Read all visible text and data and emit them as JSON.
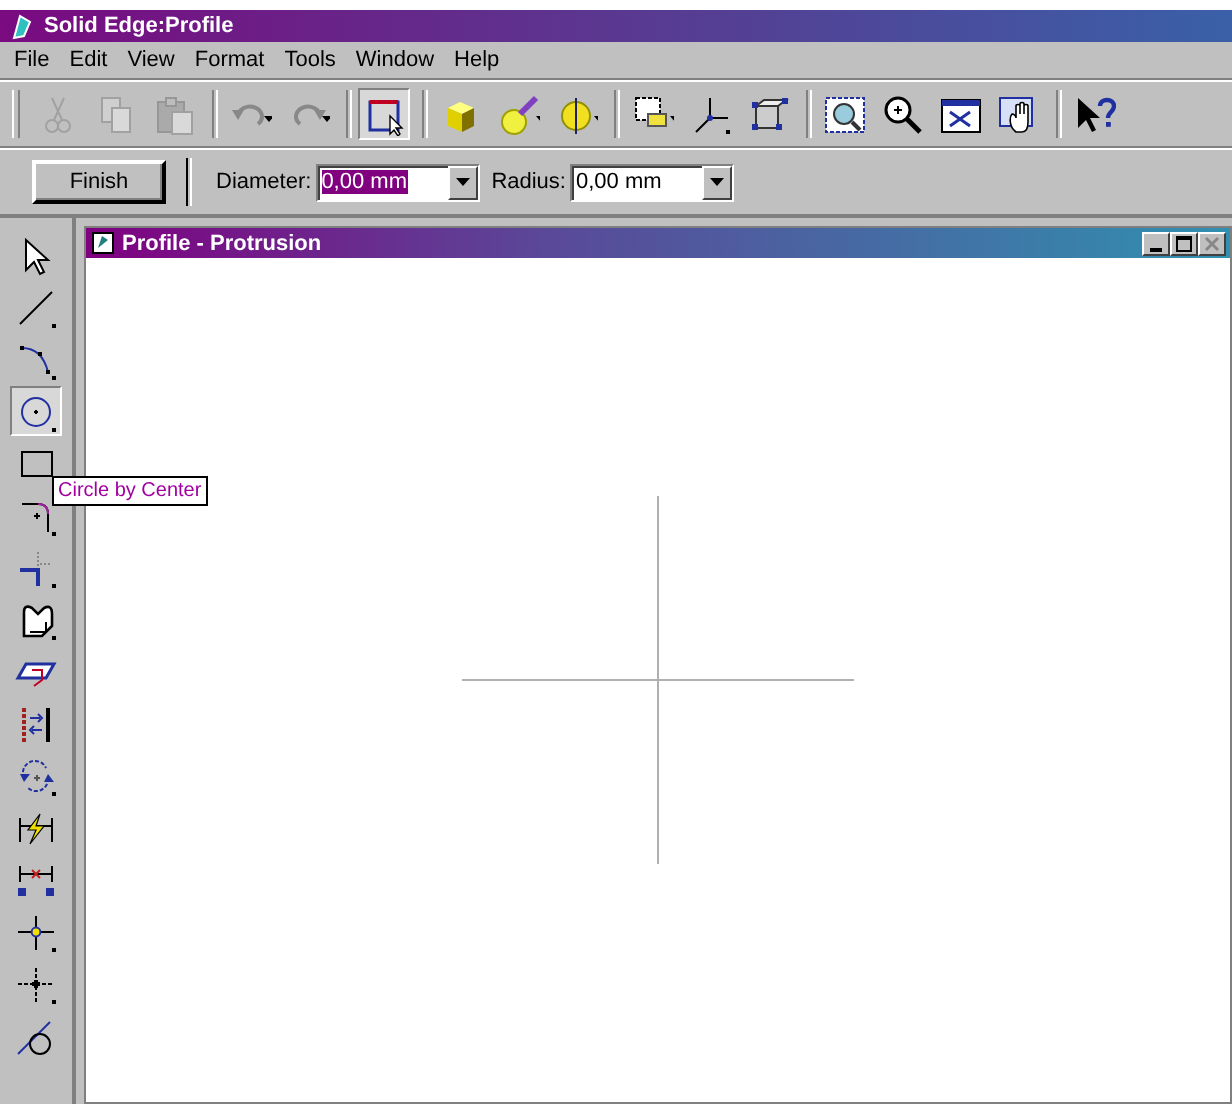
{
  "window": {
    "title": "Solid Edge:Profile"
  },
  "menu": [
    "File",
    "Edit",
    "View",
    "Format",
    "Tools",
    "Window",
    "Help"
  ],
  "toolbar": [
    {
      "disabled": true,
      "selected": false
    },
    {
      "disabled": true,
      "selected": false
    },
    {
      "disabled": true,
      "selected": false
    },
    {
      "disabled": false,
      "selected": false
    },
    {
      "disabled": false,
      "selected": false
    },
    {
      "disabled": false,
      "selected": true
    },
    {
      "disabled": false,
      "selected": false
    },
    {
      "disabled": false,
      "selected": false
    },
    {
      "disabled": false,
      "selected": false
    },
    {
      "disabled": false,
      "selected": false
    },
    {
      "disabled": false,
      "selected": false
    },
    {
      "disabled": false,
      "selected": false
    },
    {
      "disabled": false,
      "selected": false
    },
    {
      "disabled": false,
      "selected": false
    },
    {
      "disabled": false,
      "selected": false
    },
    {
      "disabled": false,
      "selected": false
    },
    {
      "disabled": false,
      "selected": false
    }
  ],
  "property_bar": {
    "finish": "Finish",
    "fields": [
      {
        "label": "Diameter:",
        "value": "0,00 mm",
        "selected": true
      },
      {
        "label": "Radius:",
        "value": "0,00 mm",
        "selected": false
      }
    ]
  },
  "left_tools": [
    {
      "selected": false
    },
    {
      "selected": false
    },
    {
      "selected": false
    },
    {
      "selected": true
    },
    {
      "selected": false
    },
    {
      "selected": false
    },
    {
      "selected": false
    },
    {
      "selected": false
    },
    {
      "selected": false
    },
    {
      "selected": false
    },
    {
      "selected": false
    },
    {
      "selected": false
    },
    {
      "selected": false
    },
    {
      "selected": false
    },
    {
      "selected": false
    },
    {
      "selected": false
    }
  ],
  "tooltip": "Circle by Center",
  "document": {
    "title": "Profile - Protrusion"
  }
}
